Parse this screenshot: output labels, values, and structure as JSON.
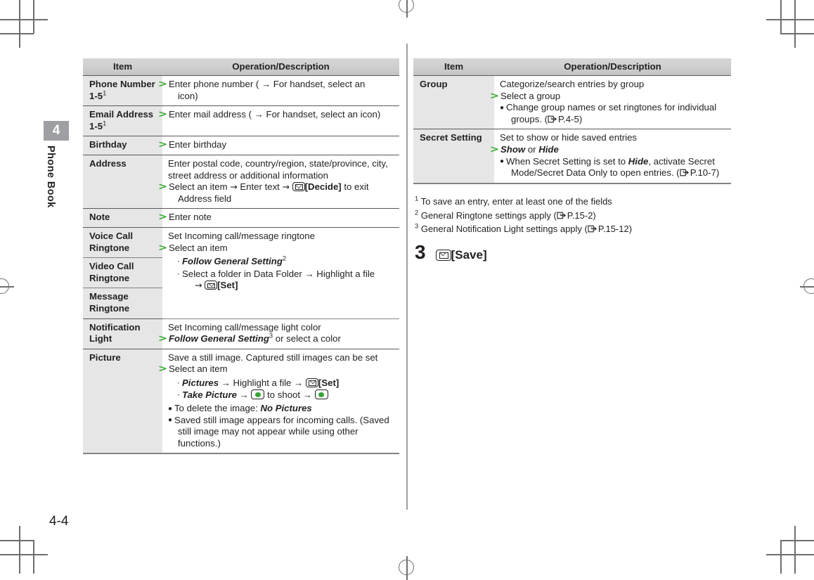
{
  "page": {
    "number": "4-4",
    "chapter_number": "4",
    "chapter_title": "Phone Book"
  },
  "tables": {
    "left": {
      "headers": [
        "Item",
        "Operation/Description"
      ],
      "rows": [
        {
          "item": "Phone Number 1-5",
          "item_sup": "1",
          "lines": [
            "Enter phone number ( → For handset, select an",
            "icon)"
          ]
        },
        {
          "item": "Email Address 1-5",
          "item_sup": "1",
          "lines": [
            "Enter mail address ( → For handset, select an icon)"
          ]
        },
        {
          "item": "Birthday",
          "lines": [
            "Enter birthday"
          ]
        },
        {
          "item": "Address",
          "lines": [
            "Enter postal code, country/region, state/province, city,",
            "street address or additional information",
            "Select an item → Enter text → [Decide] to exit",
            "Address field"
          ],
          "decide_label": "[Decide]"
        },
        {
          "item": "Note",
          "lines": [
            "Enter note"
          ]
        },
        {
          "item": "Voice Call Ringtone",
          "item2": "Video Call Ringtone",
          "item3": "Message Ringtone",
          "lines": [
            "Set Incoming call/message ringtone",
            "Select an item",
            "Follow General Setting",
            "Select a folder in Data Folder → Highlight a file",
            "→ [Set]"
          ],
          "follow_sup": "2",
          "set_label": "[Set]"
        },
        {
          "item": "Notification Light",
          "lines": [
            "Set Incoming call/message light color",
            "Follow General Setting",
            " or select a color"
          ],
          "follow_sup": "3"
        },
        {
          "item": "Picture",
          "lines": [
            "Save a still image. Captured still images can be set",
            "Select an item",
            "Pictures",
            " → Highlight a file → ",
            "[Set]",
            "Take Picture",
            " → ",
            " to shoot → ",
            "To delete the image: ",
            "No Pictures",
            "Saved still image appears for incoming calls. (Saved",
            "still image may not appear while using other",
            "functions.)"
          ]
        }
      ]
    },
    "right": {
      "headers": [
        "Item",
        "Operation/Description"
      ],
      "rows": [
        {
          "item": "Group",
          "lines": [
            "Categorize/search entries by group",
            "Select a group",
            "Change group names or set ringtones for individual",
            "groups. (",
            "P.4-5)"
          ]
        },
        {
          "item": "Secret Setting",
          "lines": [
            "Set to show or hide saved entries",
            "Show",
            " or ",
            "Hide",
            "When Secret Setting is set to ",
            "Hide",
            ", activate Secret",
            "Mode/Secret Data Only to open entries. (",
            "P.10-7)"
          ]
        }
      ]
    }
  },
  "footnotes": [
    {
      "num": "1",
      "text": "To save an entry, enter at least one of the fields",
      "ref": ""
    },
    {
      "num": "2",
      "text": "General Ringtone settings apply (",
      "ref": "P.15-2)"
    },
    {
      "num": "3",
      "text": "General Notification Light settings apply (",
      "ref": "P.15-12)"
    }
  ],
  "step": {
    "number": "3",
    "label": "[Save]"
  },
  "icons": {
    "mail_key": "mail-key-icon",
    "center_key": "center-key-icon",
    "page_ref": "page-reference-icon",
    "step_marker": "green-chevron-icon",
    "bullet": "bullet-icon"
  },
  "colors": {
    "accent_green": "#3aa935",
    "key_green": "#36a536",
    "item_bg": "#e6e6e6",
    "header_bg": "#cfcfcf",
    "rule": "#58595b",
    "tab_bg": "#9d9fa2",
    "text": "#231f20"
  }
}
